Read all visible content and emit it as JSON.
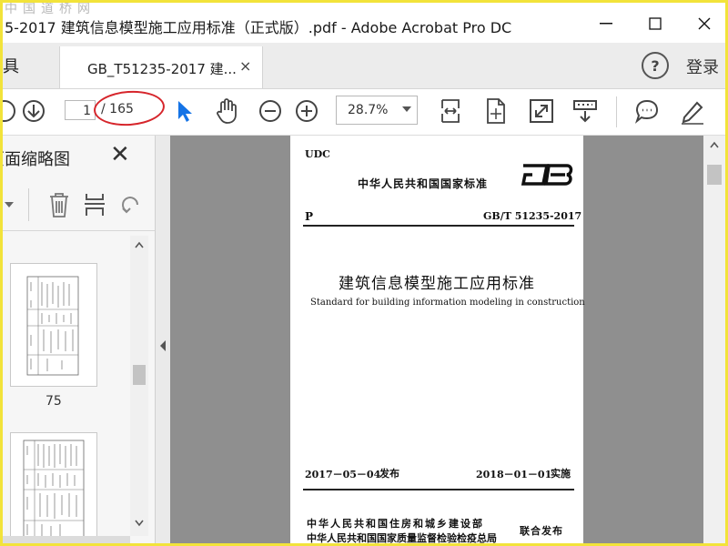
{
  "window": {
    "title": "5-2017 建筑信息模型施工应用标准（正式版）.pdf - Adobe Acrobat Pro DC",
    "watermark": "中国道桥网"
  },
  "tabs": {
    "tools_label": "具",
    "doc_tab_label": "GB_T51235-2017 建...",
    "close_glyph": "×",
    "help_glyph": "?",
    "login_label": "登录"
  },
  "toolbar": {
    "page_current": "1",
    "page_total": "/ 165",
    "zoom": "28.7%",
    "highlight_color": "#d6252b",
    "accent_color": "#1473e6"
  },
  "sidebar": {
    "title": "页面缩略图",
    "close_glyph": "✕",
    "thumbnail_labels": [
      "75"
    ]
  },
  "document": {
    "udc": "UDC",
    "issuer_line": "中华人民共和国国家标准",
    "gb_logo": "GB",
    "category": "P",
    "std_number": "GB/T 51235-2017",
    "title_zh": "建筑信息模型施工应用标准",
    "title_en": "Standard for building information modeling in construction",
    "issue_date": "2017－05－04",
    "issue_word": "发布",
    "impl_date": "2018－01－01",
    "impl_word": "实施",
    "publisher1": "中华人民共和国住房和城乡建设部",
    "publisher2": "中华人民共和国国家质量监督检验检疫总局",
    "joint_publish": "联合发布"
  },
  "icons": [
    "scroll-up-icon",
    "scroll-down-icon",
    "select-cursor-icon",
    "hand-tool-icon",
    "zoom-out-icon",
    "zoom-in-icon",
    "fit-width-icon",
    "fit-page-icon",
    "full-screen-icon",
    "read-mode-icon",
    "comment-icon",
    "sign-pen-icon",
    "delete-icon",
    "extract-page-icon",
    "undo-icon"
  ]
}
